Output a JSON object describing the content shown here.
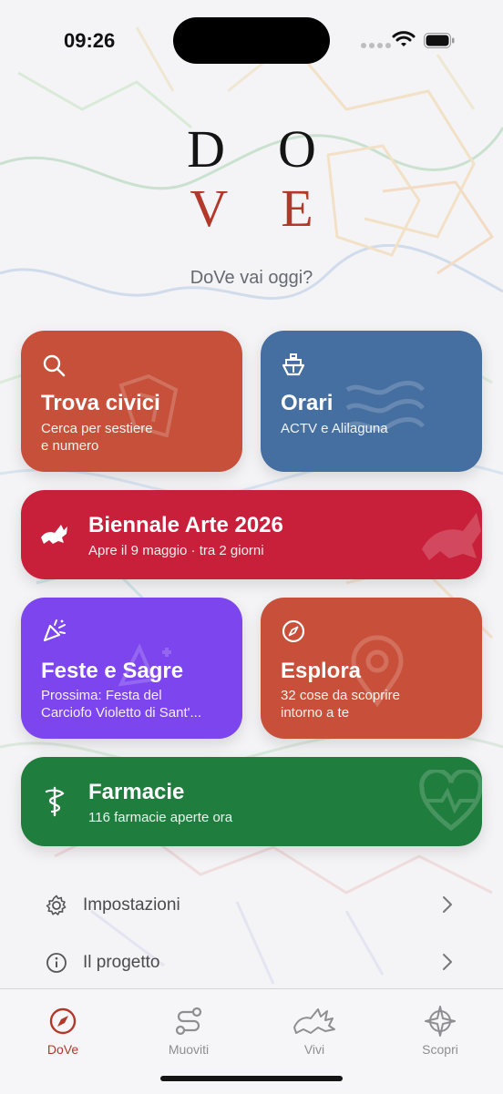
{
  "status_bar": {
    "time": "09:26"
  },
  "logo": {
    "row1_left": "D",
    "row1_right": "O",
    "row2_left": "V",
    "row2_right": "E"
  },
  "tagline": "DoVe vai oggi?",
  "cards": {
    "trova": {
      "title": "Trova civici",
      "subtitle_line1": "Cerca per sestiere",
      "subtitle_line2": "e numero",
      "color": "#c6503a"
    },
    "orari": {
      "title": "Orari",
      "subtitle": "ACTV e Alilaguna",
      "color": "#456fa0"
    },
    "biennale": {
      "title": "Biennale Arte 2026",
      "subtitle": "Apre il 9 maggio · tra 2 giorni",
      "color": "#c8203a"
    },
    "feste": {
      "title": "Feste e Sagre",
      "subtitle_line1": "Prossima: Festa del",
      "subtitle_line2": "Carciofo Violetto di Sant'...",
      "color": "#7c45ee"
    },
    "esplora": {
      "title": "Esplora",
      "subtitle_line1": "32 cose da scoprire",
      "subtitle_line2": "intorno a te",
      "color": "#c8503a"
    },
    "farmacie": {
      "title": "Farmacie",
      "subtitle": "116 farmacie aperte ora",
      "color": "#1f7d3e"
    }
  },
  "list": {
    "settings_label": "Impostazioni",
    "project_label": "Il progetto"
  },
  "tabs": [
    {
      "label": "DoVe",
      "icon": "compass-icon",
      "active": true
    },
    {
      "label": "Muoviti",
      "icon": "route-icon",
      "active": false
    },
    {
      "label": "Vivi",
      "icon": "lion-icon",
      "active": false
    },
    {
      "label": "Scopri",
      "icon": "compass-rose-icon",
      "active": false
    }
  ],
  "colors": {
    "accent": "#b4382a",
    "inactive_tab": "#8e8e93"
  }
}
